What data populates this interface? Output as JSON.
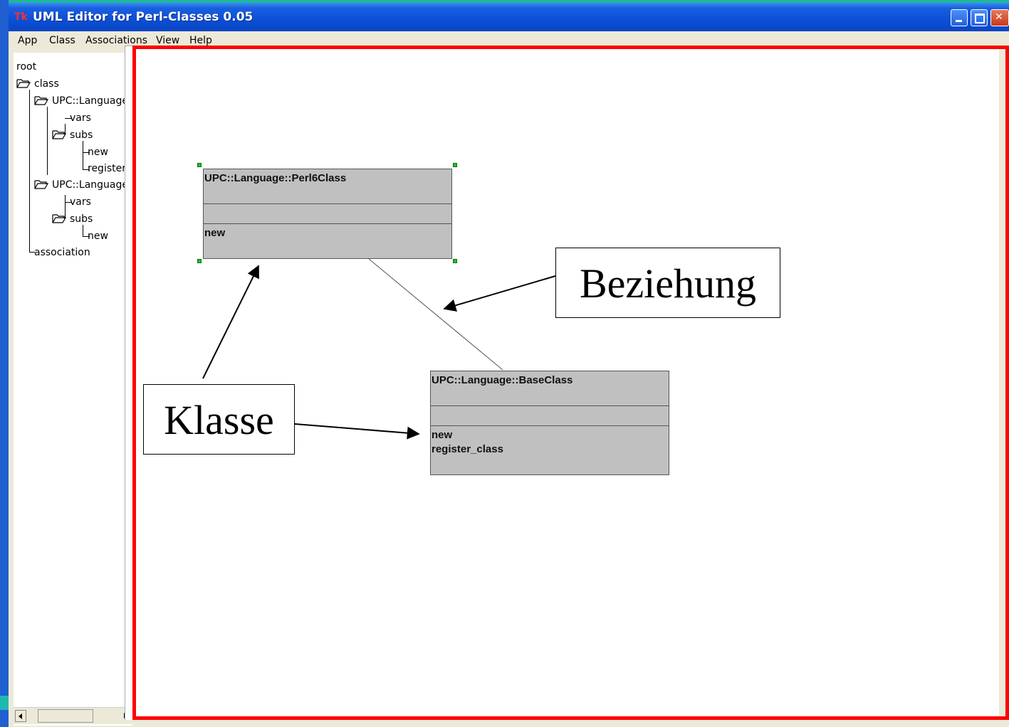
{
  "window": {
    "title": "UML Editor for Perl-Classes 0.05",
    "app_icon": "Tk"
  },
  "menu": {
    "items": [
      "App",
      "Class",
      "Associations",
      "View",
      "Help"
    ]
  },
  "tree": {
    "root": "root",
    "class": "class",
    "class1": "UPC::Language:",
    "vars1": "vars",
    "subs1": "subs",
    "new1": "new",
    "register1": "register_c",
    "class2": "UPC::Language:",
    "vars2": "vars",
    "subs2": "subs",
    "new2": "new",
    "association": "association"
  },
  "diagram": {
    "class_a": {
      "name": "UPC::Language::Perl6Class",
      "methods": [
        "new"
      ]
    },
    "class_b": {
      "name": "UPC::Language::BaseClass",
      "methods": [
        "new",
        "register_class"
      ]
    }
  },
  "annotations": {
    "beziehung": "Beziehung",
    "klasse": "Klasse"
  },
  "colors": {
    "highlight_frame": "#ff0000",
    "class_fill": "#c0c0c0",
    "selection_handle": "#20c020",
    "titlebar": "#0b4fd6"
  }
}
